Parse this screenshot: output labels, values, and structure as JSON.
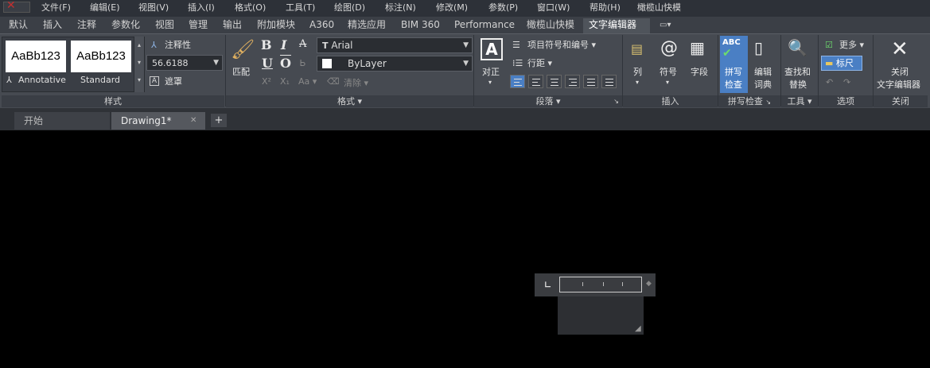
{
  "menubar": {
    "items": [
      "文件(F)",
      "编辑(E)",
      "视图(V)",
      "插入(I)",
      "格式(O)",
      "工具(T)",
      "绘图(D)",
      "标注(N)",
      "修改(M)",
      "参数(P)",
      "窗口(W)",
      "帮助(H)",
      "橄榄山快模"
    ]
  },
  "ribbon_tabs": [
    "默认",
    "插入",
    "注释",
    "参数化",
    "视图",
    "管理",
    "输出",
    "附加模块",
    "A360",
    "精选应用",
    "BIM 360",
    "Performance",
    "橄榄山快模",
    "文字编辑器"
  ],
  "active_tab": "文字编辑器",
  "style_panel": {
    "styles": [
      "AaBb123",
      "AaBb123"
    ],
    "style_names": [
      "Annotative",
      "Standard"
    ],
    "annotative_label": "注释性",
    "height_value": "56.6188",
    "mask_label": "遮罩",
    "title": "样式"
  },
  "format_panel": {
    "match_label": "匹配",
    "bold": "B",
    "italic": "I",
    "strike": "A",
    "underline": "U",
    "overline": "O",
    "font_value": "Arial",
    "color_value": "ByLayer",
    "clear_label": "清除",
    "title": "格式"
  },
  "paragraph_panel": {
    "justify_label": "对正",
    "bullets_label": "项目符号和编号",
    "line_spacing_label": "行距",
    "title": "段落"
  },
  "insert_panel": {
    "columns_label": "列",
    "symbol_label": "符号",
    "field_label": "字段",
    "title": "插入"
  },
  "spell_panel": {
    "spell_label_1": "拼写",
    "spell_label_2": "检查",
    "dict_label_1": "编辑",
    "dict_label_2": "词典",
    "title": "拼写检查"
  },
  "tools_panel": {
    "find_label_1": "查找和",
    "find_label_2": "替换",
    "title": "工具"
  },
  "options_panel": {
    "more_label": "更多",
    "ruler_label": "标尺",
    "title": "选项"
  },
  "close_panel": {
    "close_label_1": "关闭",
    "close_label_2": "文字编辑器",
    "title": "关闭"
  },
  "doc_tabs": [
    "开始",
    "Drawing1*"
  ],
  "colors": {
    "accent": "#4a7fc4",
    "ribbon": "#464a51",
    "canvas": "#000000"
  }
}
